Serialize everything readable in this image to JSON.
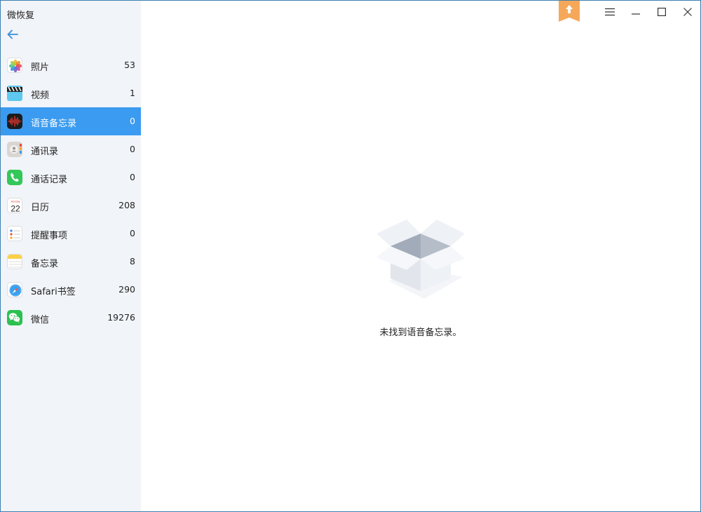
{
  "app": {
    "title": "微恢复"
  },
  "sidebar": {
    "items": [
      {
        "id": "photos",
        "label": "照片",
        "count": "53",
        "icon": "photos-icon",
        "active": false
      },
      {
        "id": "videos",
        "label": "视频",
        "count": "1",
        "icon": "video-icon",
        "active": false
      },
      {
        "id": "voice-memos",
        "label": "语音备忘录",
        "count": "0",
        "icon": "voice-memo-icon",
        "active": true
      },
      {
        "id": "contacts",
        "label": "通讯录",
        "count": "0",
        "icon": "contacts-icon",
        "active": false
      },
      {
        "id": "call-log",
        "label": "通话记录",
        "count": "0",
        "icon": "phone-icon",
        "active": false
      },
      {
        "id": "calendar",
        "label": "日历",
        "count": "208",
        "icon": "calendar-icon",
        "active": false
      },
      {
        "id": "reminders",
        "label": "提醒事项",
        "count": "0",
        "icon": "reminders-icon",
        "active": false
      },
      {
        "id": "notes",
        "label": "备忘录",
        "count": "8",
        "icon": "notes-icon",
        "active": false
      },
      {
        "id": "safari",
        "label": "Safari书签",
        "count": "290",
        "icon": "safari-icon",
        "active": false
      },
      {
        "id": "wechat",
        "label": "微信",
        "count": "19276",
        "icon": "wechat-icon",
        "active": false
      }
    ]
  },
  "calendar_icon": {
    "month": "Monday",
    "day": "22"
  },
  "main": {
    "empty_message": "未找到语音备忘录。"
  },
  "colors": {
    "accent": "#3a9bf0",
    "sidebar_bg": "#f1f4f8",
    "upgrade": "#f5a85a"
  }
}
